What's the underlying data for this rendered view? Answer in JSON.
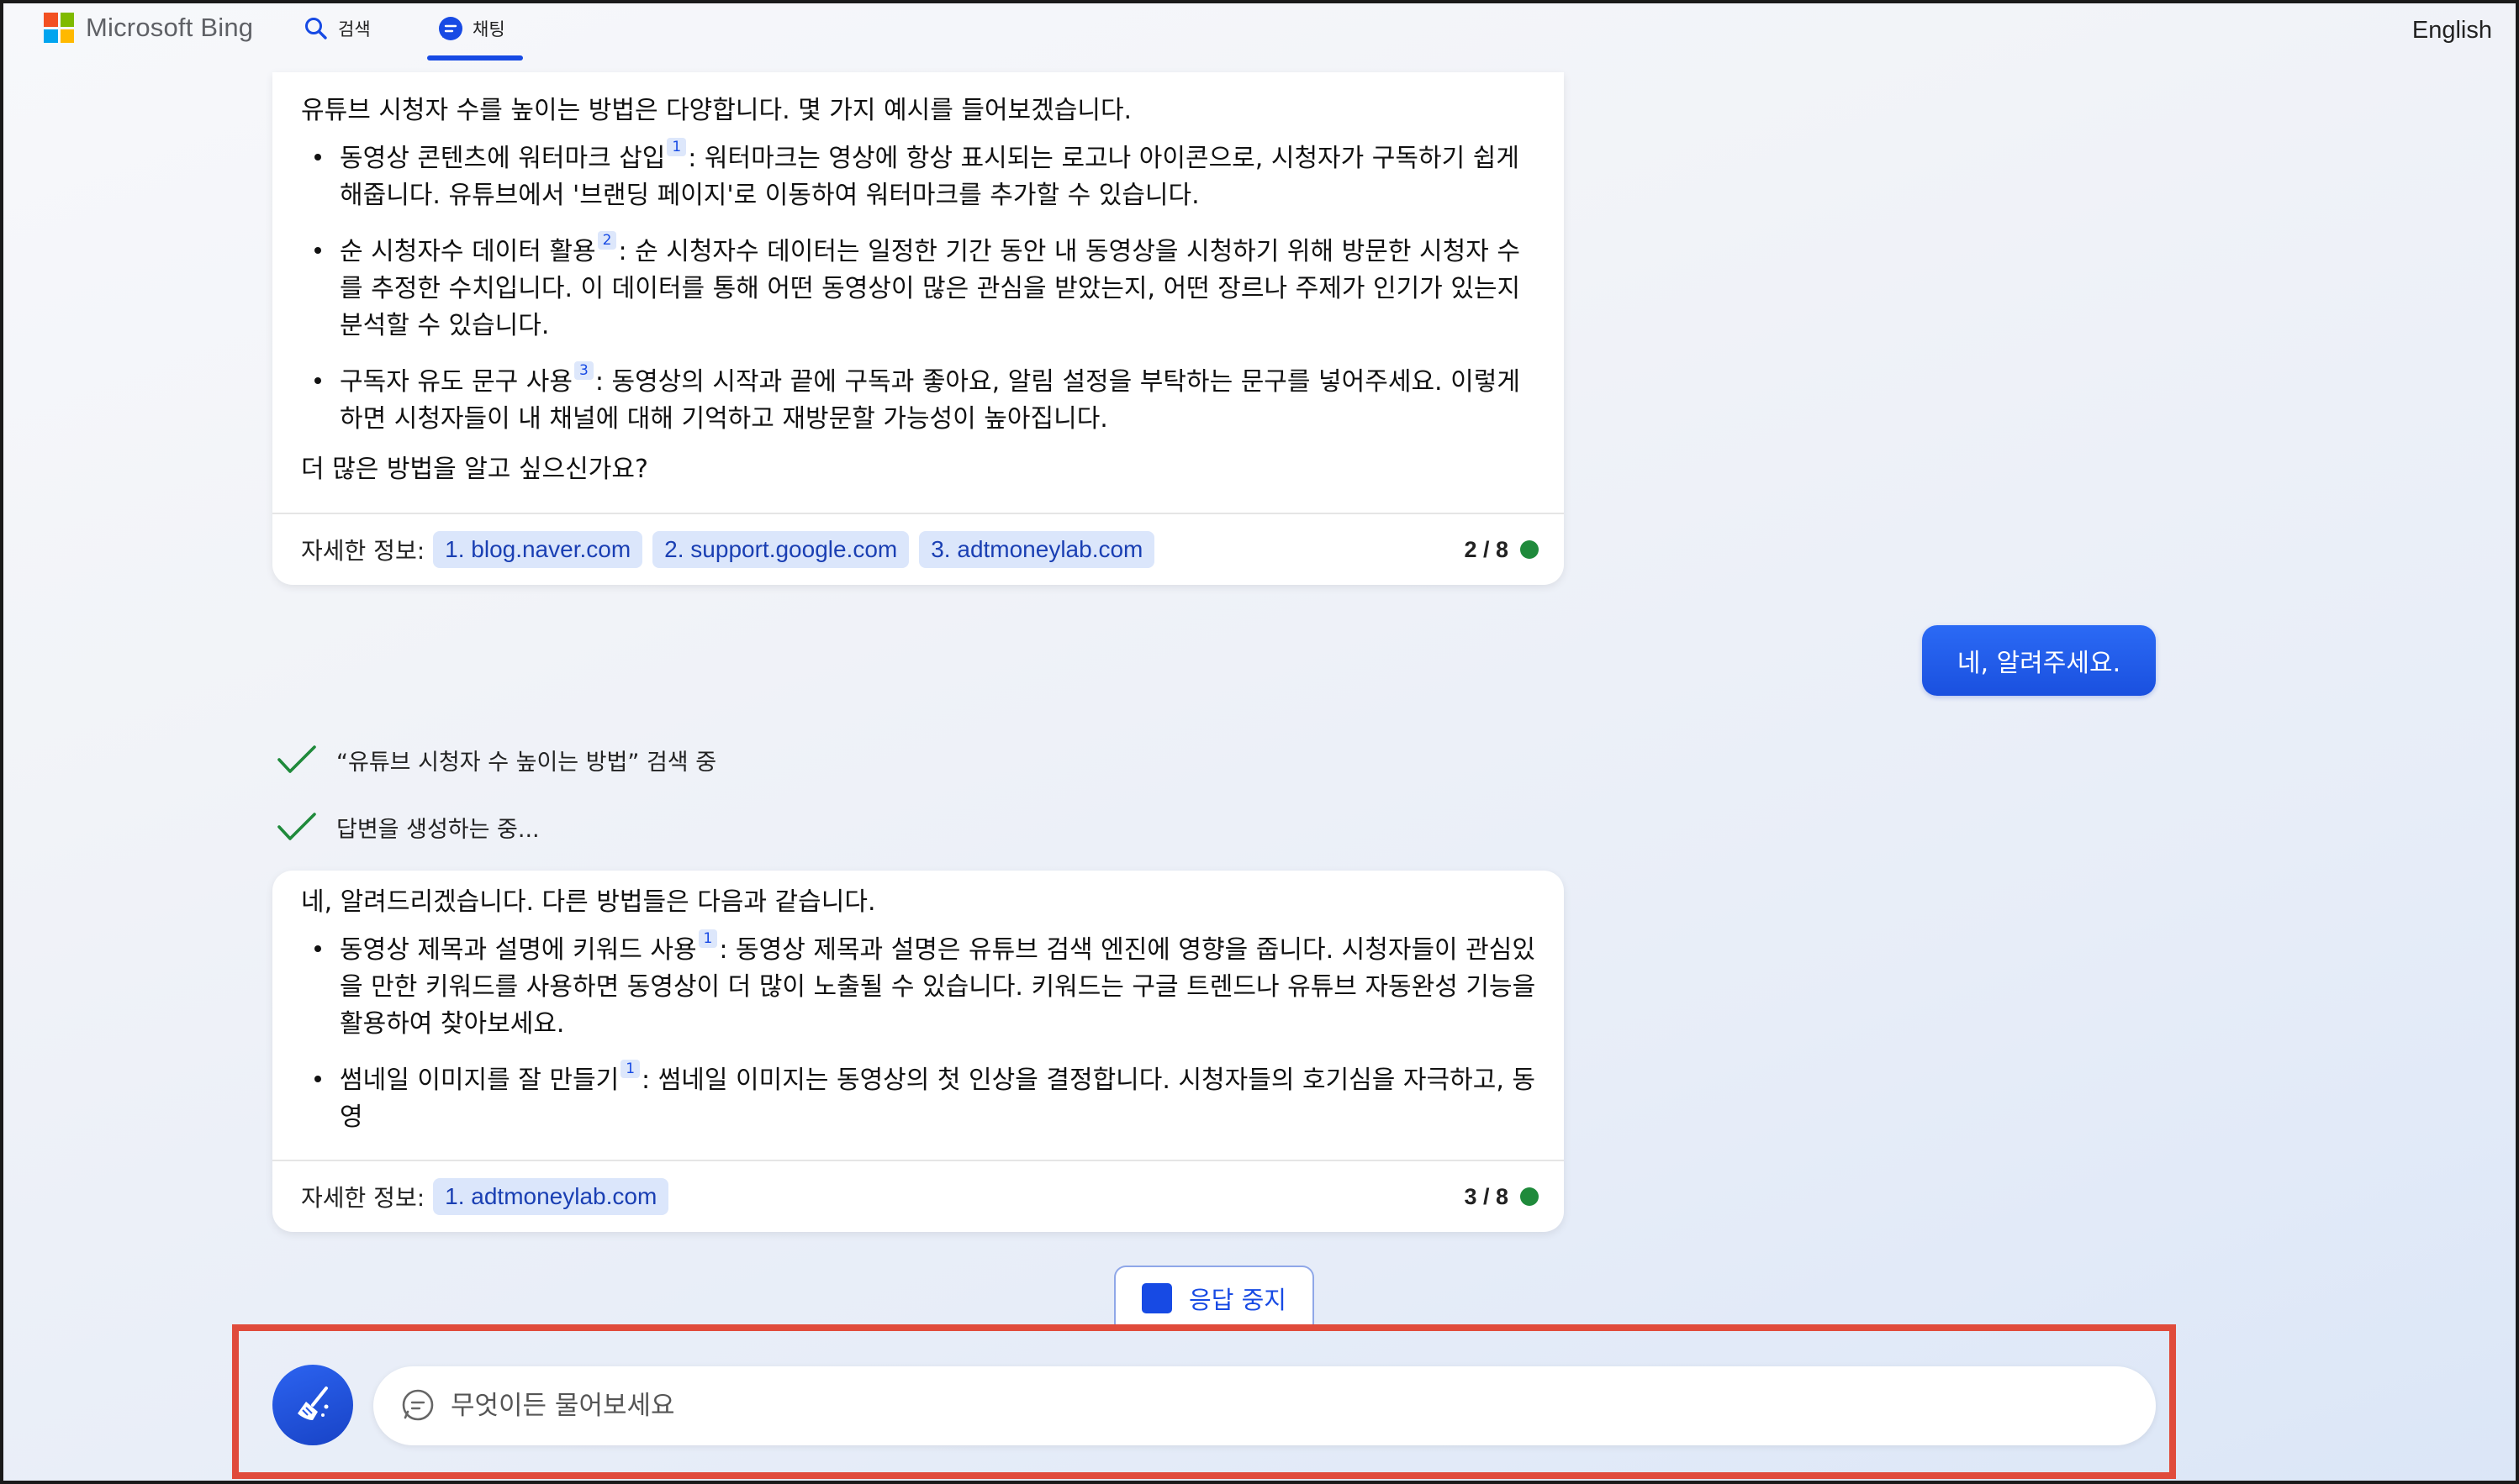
{
  "header": {
    "logo_text": "Microsoft Bing",
    "tabs": [
      {
        "label": "검색",
        "icon": "search-icon"
      },
      {
        "label": "채팅",
        "icon": "chat-icon",
        "active": true
      }
    ],
    "language": "English"
  },
  "colors": {
    "accent": "#174ae4",
    "status_green": "#1f8a3b",
    "highlight_border": "#e04b3b"
  },
  "messages": {
    "first_card": {
      "intro": "유튜브 시청자 수를 높이는 방법은 다양합니다. 몇 가지 예시를 들어보겠습니다.",
      "items": [
        {
          "title": "동영상 콘텐츠에 워터마크 삽입",
          "ref": "1",
          "text": ": 워터마크는 영상에 항상 표시되는 로고나 아이콘으로, 시청자가 구독하기 쉽게 해줍니다. 유튜브에서 '브랜딩 페이지'로 이동하여 워터마크를 추가할 수 있습니다."
        },
        {
          "title": "순 시청자수 데이터 활용",
          "ref": "2",
          "text": ": 순 시청자수 데이터는 일정한 기간 동안 내 동영상을 시청하기 위해 방문한 시청자 수를 추정한 수치입니다. 이 데이터를 통해 어떤 동영상이 많은 관심을 받았는지, 어떤 장르나 주제가 인기가 있는지 분석할 수 있습니다."
        },
        {
          "title": "구독자 유도 문구 사용",
          "ref": "3",
          "text": ": 동영상의 시작과 끝에 구독과 좋아요, 알림 설정을 부탁하는 문구를 넣어주세요. 이렇게 하면 시청자들이 내 채널에 대해 기억하고 재방문할 가능성이 높아집니다."
        }
      ],
      "outro": "더 많은 방법을 알고 싶으신가요?",
      "footer_label": "자세한 정보:",
      "sources": [
        "1. blog.naver.com",
        "2. support.google.com",
        "3. adtmoneylab.com"
      ],
      "counter": "2 / 8"
    },
    "user_message": "네, 알려주세요.",
    "status": [
      "“유튜브 시청자 수 높이는 방법” 검색 중",
      "답변을 생성하는 중..."
    ],
    "second_card": {
      "intro": "네, 알려드리겠습니다. 다른 방법들은 다음과 같습니다.",
      "items": [
        {
          "title": "동영상 제목과 설명에 키워드 사용",
          "ref": "1",
          "text": ": 동영상 제목과 설명은 유튜브 검색 엔진에 영향을 줍니다. 시청자들이 관심있을 만한 키워드를 사용하면 동영상이 더 많이 노출될 수 있습니다. 키워드는 구글 트렌드나 유튜브 자동완성 기능을 활용하여 찾아보세요."
        },
        {
          "title": "썸네일 이미지를 잘 만들기",
          "ref": "1",
          "text": ": 썸네일 이미지는 동영상의 첫 인상을 결정합니다. 시청자들의 호기심을 자극하고, 동영"
        }
      ],
      "footer_label": "자세한 정보:",
      "sources": [
        "1. adtmoneylab.com"
      ],
      "counter": "3 / 8"
    }
  },
  "stop_button": {
    "label": "응답 중지"
  },
  "input": {
    "placeholder": "무엇이든 물어보세요",
    "value": ""
  }
}
